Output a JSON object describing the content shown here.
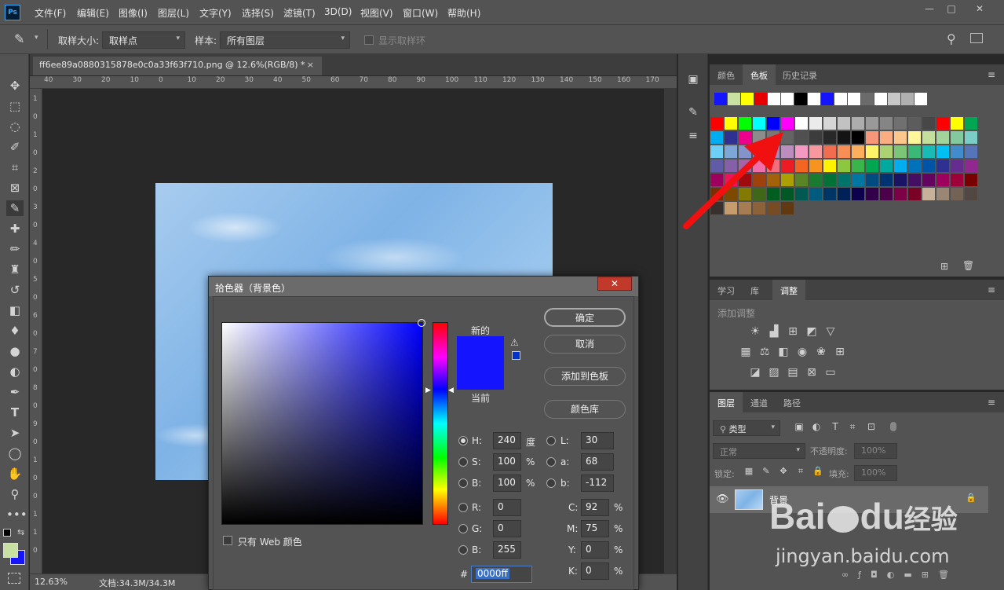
{
  "menubar": {
    "logo": "Ps",
    "items": [
      "文件(F)",
      "编辑(E)",
      "图像(I)",
      "图层(L)",
      "文字(Y)",
      "选择(S)",
      "滤镜(T)",
      "3D(D)",
      "视图(V)",
      "窗口(W)",
      "帮助(H)"
    ],
    "win_min": "—",
    "win_max": "□",
    "win_close": "✕"
  },
  "options": {
    "sample_size_label": "取样大小:",
    "sample_size_value": "取样点",
    "sample_label": "样本:",
    "sample_value": "所有图层",
    "show_ring_label": "显示取样环"
  },
  "document": {
    "tab_title": "ff6ee89a0880315878e0c0a33f63f710.png @ 12.6%(RGB/8) *",
    "tab_close": "×",
    "zoom": "12.63%",
    "doc_size": "文档:34.3M/34.3M"
  },
  "ruler": {
    "h_ticks": [
      "40",
      "30",
      "20",
      "10",
      "0",
      "10",
      "20",
      "30",
      "40",
      "50",
      "60",
      "70",
      "80",
      "90",
      "100",
      "110",
      "120",
      "130",
      "140",
      "150",
      "160",
      "170"
    ],
    "v_ticks": [
      "1",
      "0",
      "1",
      "0",
      "2",
      "0",
      "3",
      "0",
      "4",
      "0",
      "5",
      "0",
      "6",
      "0",
      "7",
      "0",
      "8",
      "0",
      "9",
      "0",
      "1",
      "0",
      "0",
      "1",
      "1",
      "0"
    ]
  },
  "swatches_panel": {
    "tabs": [
      "颜色",
      "色板",
      "历史记录"
    ],
    "active_tab": "色板",
    "recent_colors": [
      "#1414ff",
      "#c8e0a0",
      "#ffff00",
      "#e60000",
      "#ffffff",
      "#ffffff",
      "#000000",
      "#ffffff",
      "#1414ff",
      "#ffffff",
      "#ffffff",
      "#6b6b6b",
      "#ffffff",
      "#c8c8c8",
      "#b0b0b0",
      "#ffffff"
    ],
    "rows": [
      [
        "#ff0000",
        "#ffff00",
        "#00ff00",
        "#00ffff",
        "#0000ff",
        "#ff00ff",
        "#ffffff",
        "#ebebeb",
        "#d6d6d6",
        "#c2c2c2",
        "#adadad",
        "#999999",
        "#858585",
        "#707070",
        "#5c5c5c",
        "#474747",
        "#ff0000",
        "#ffff00",
        "#00a651"
      ],
      [
        "#00aeef",
        "#2e3192",
        "#ec008c",
        "#8c8c8c",
        "#787878",
        "#646464",
        "#505050",
        "#3c3c3c",
        "#282828",
        "#141414",
        "#000000",
        "#f7977a",
        "#fbad82",
        "#fdc68a",
        "#fff79a",
        "#c4df9b",
        "#a2d39c",
        "#82ca9d",
        "#7bcdc8"
      ],
      [
        "#6ecff6",
        "#7ea7d8",
        "#8493ca",
        "#8882be",
        "#a187be",
        "#bc8dbf",
        "#f49ac2",
        "#f6989d",
        "#f26c4f",
        "#f68e55",
        "#fbaf5c",
        "#fff467",
        "#acd372",
        "#7cc576",
        "#3bb878",
        "#1abbb4",
        "#00bff3",
        "#438ccb",
        "#5574b9"
      ],
      [
        "#605ca8",
        "#855fa8",
        "#a763a8",
        "#f06ea9",
        "#f26d7d",
        "#ed1c24",
        "#f26522",
        "#f7941d",
        "#fff200",
        "#8dc73f",
        "#39b54a",
        "#00a651",
        "#00a99d",
        "#00aeef",
        "#0072bc",
        "#0054a6",
        "#2e3192",
        "#662d91",
        "#92278f"
      ],
      [
        "#9e005d",
        "#ed145b",
        "#9e0b0f",
        "#a0410d",
        "#a3620a",
        "#aba000",
        "#598527",
        "#197b30",
        "#007236",
        "#00746b",
        "#0076a3",
        "#004b80",
        "#003471",
        "#1b1464",
        "#440e62",
        "#630460",
        "#9e005d",
        "#9e0039",
        "#790000"
      ],
      [
        "#7b2e00",
        "#7d4900",
        "#827b00",
        "#406618",
        "#005e20",
        "#005826",
        "#005952",
        "#005b7f",
        "#003663",
        "#002157",
        "#0d004c",
        "#32004b",
        "#4b0049",
        "#7b0046",
        "#7a0026",
        "#c7b299",
        "#998675",
        "#736357",
        "#534741"
      ],
      [
        "#37302d",
        "#c69c6d",
        "#a67c52",
        "#8c6239",
        "#754c24",
        "#603913"
      ]
    ]
  },
  "adjust_panel": {
    "tabs": [
      "学习",
      "库",
      "调整"
    ],
    "active_tab": "调整",
    "title": "添加调整"
  },
  "layers_panel": {
    "tabs": [
      "图层",
      "通道",
      "路径"
    ],
    "active_tab": "图层",
    "filter_label": "类型",
    "blend_mode": "正常",
    "opacity_label": "不透明度:",
    "opacity_value": "100%",
    "lock_label": "锁定:",
    "fill_label": "填充:",
    "fill_value": "100%",
    "layer_name": "背景"
  },
  "color_picker": {
    "title": "拾色器（背景色）",
    "close": "✕",
    "new_label": "新的",
    "current_label": "当前",
    "new_color": "#1414ff",
    "current_color": "#1414ff",
    "ok": "确定",
    "cancel": "取消",
    "add_to_swatches": "添加到色板",
    "color_libraries": "颜色库",
    "web_only_label": "只有 Web 颜色",
    "hsb": {
      "h_label": "H:",
      "h": "240",
      "h_unit": "度",
      "s_label": "S:",
      "s": "100",
      "s_unit": "%",
      "b_label": "B:",
      "b": "100",
      "b_unit": "%"
    },
    "rgb": {
      "r_label": "R:",
      "r": "0",
      "g_label": "G:",
      "g": "0",
      "b_label": "B:",
      "b": "255"
    },
    "lab": {
      "l_label": "L:",
      "l": "30",
      "a_label": "a:",
      "a": "68",
      "b_label": "b:",
      "b": "-112"
    },
    "cmyk": {
      "c_label": "C:",
      "c": "92",
      "m_label": "M:",
      "m": "75",
      "y_label": "Y:",
      "y": "0",
      "k_label": "K:",
      "k": "0",
      "unit": "%"
    },
    "hex_label": "#",
    "hex": "0000ff"
  },
  "toolbar": {
    "foreground_color": "#c8e0a0",
    "background_color": "#1414ff"
  },
  "watermark": {
    "brand": "Bai",
    "brand2": "du",
    "brand_cn": "经验",
    "url": "jingyan.baidu.com"
  }
}
